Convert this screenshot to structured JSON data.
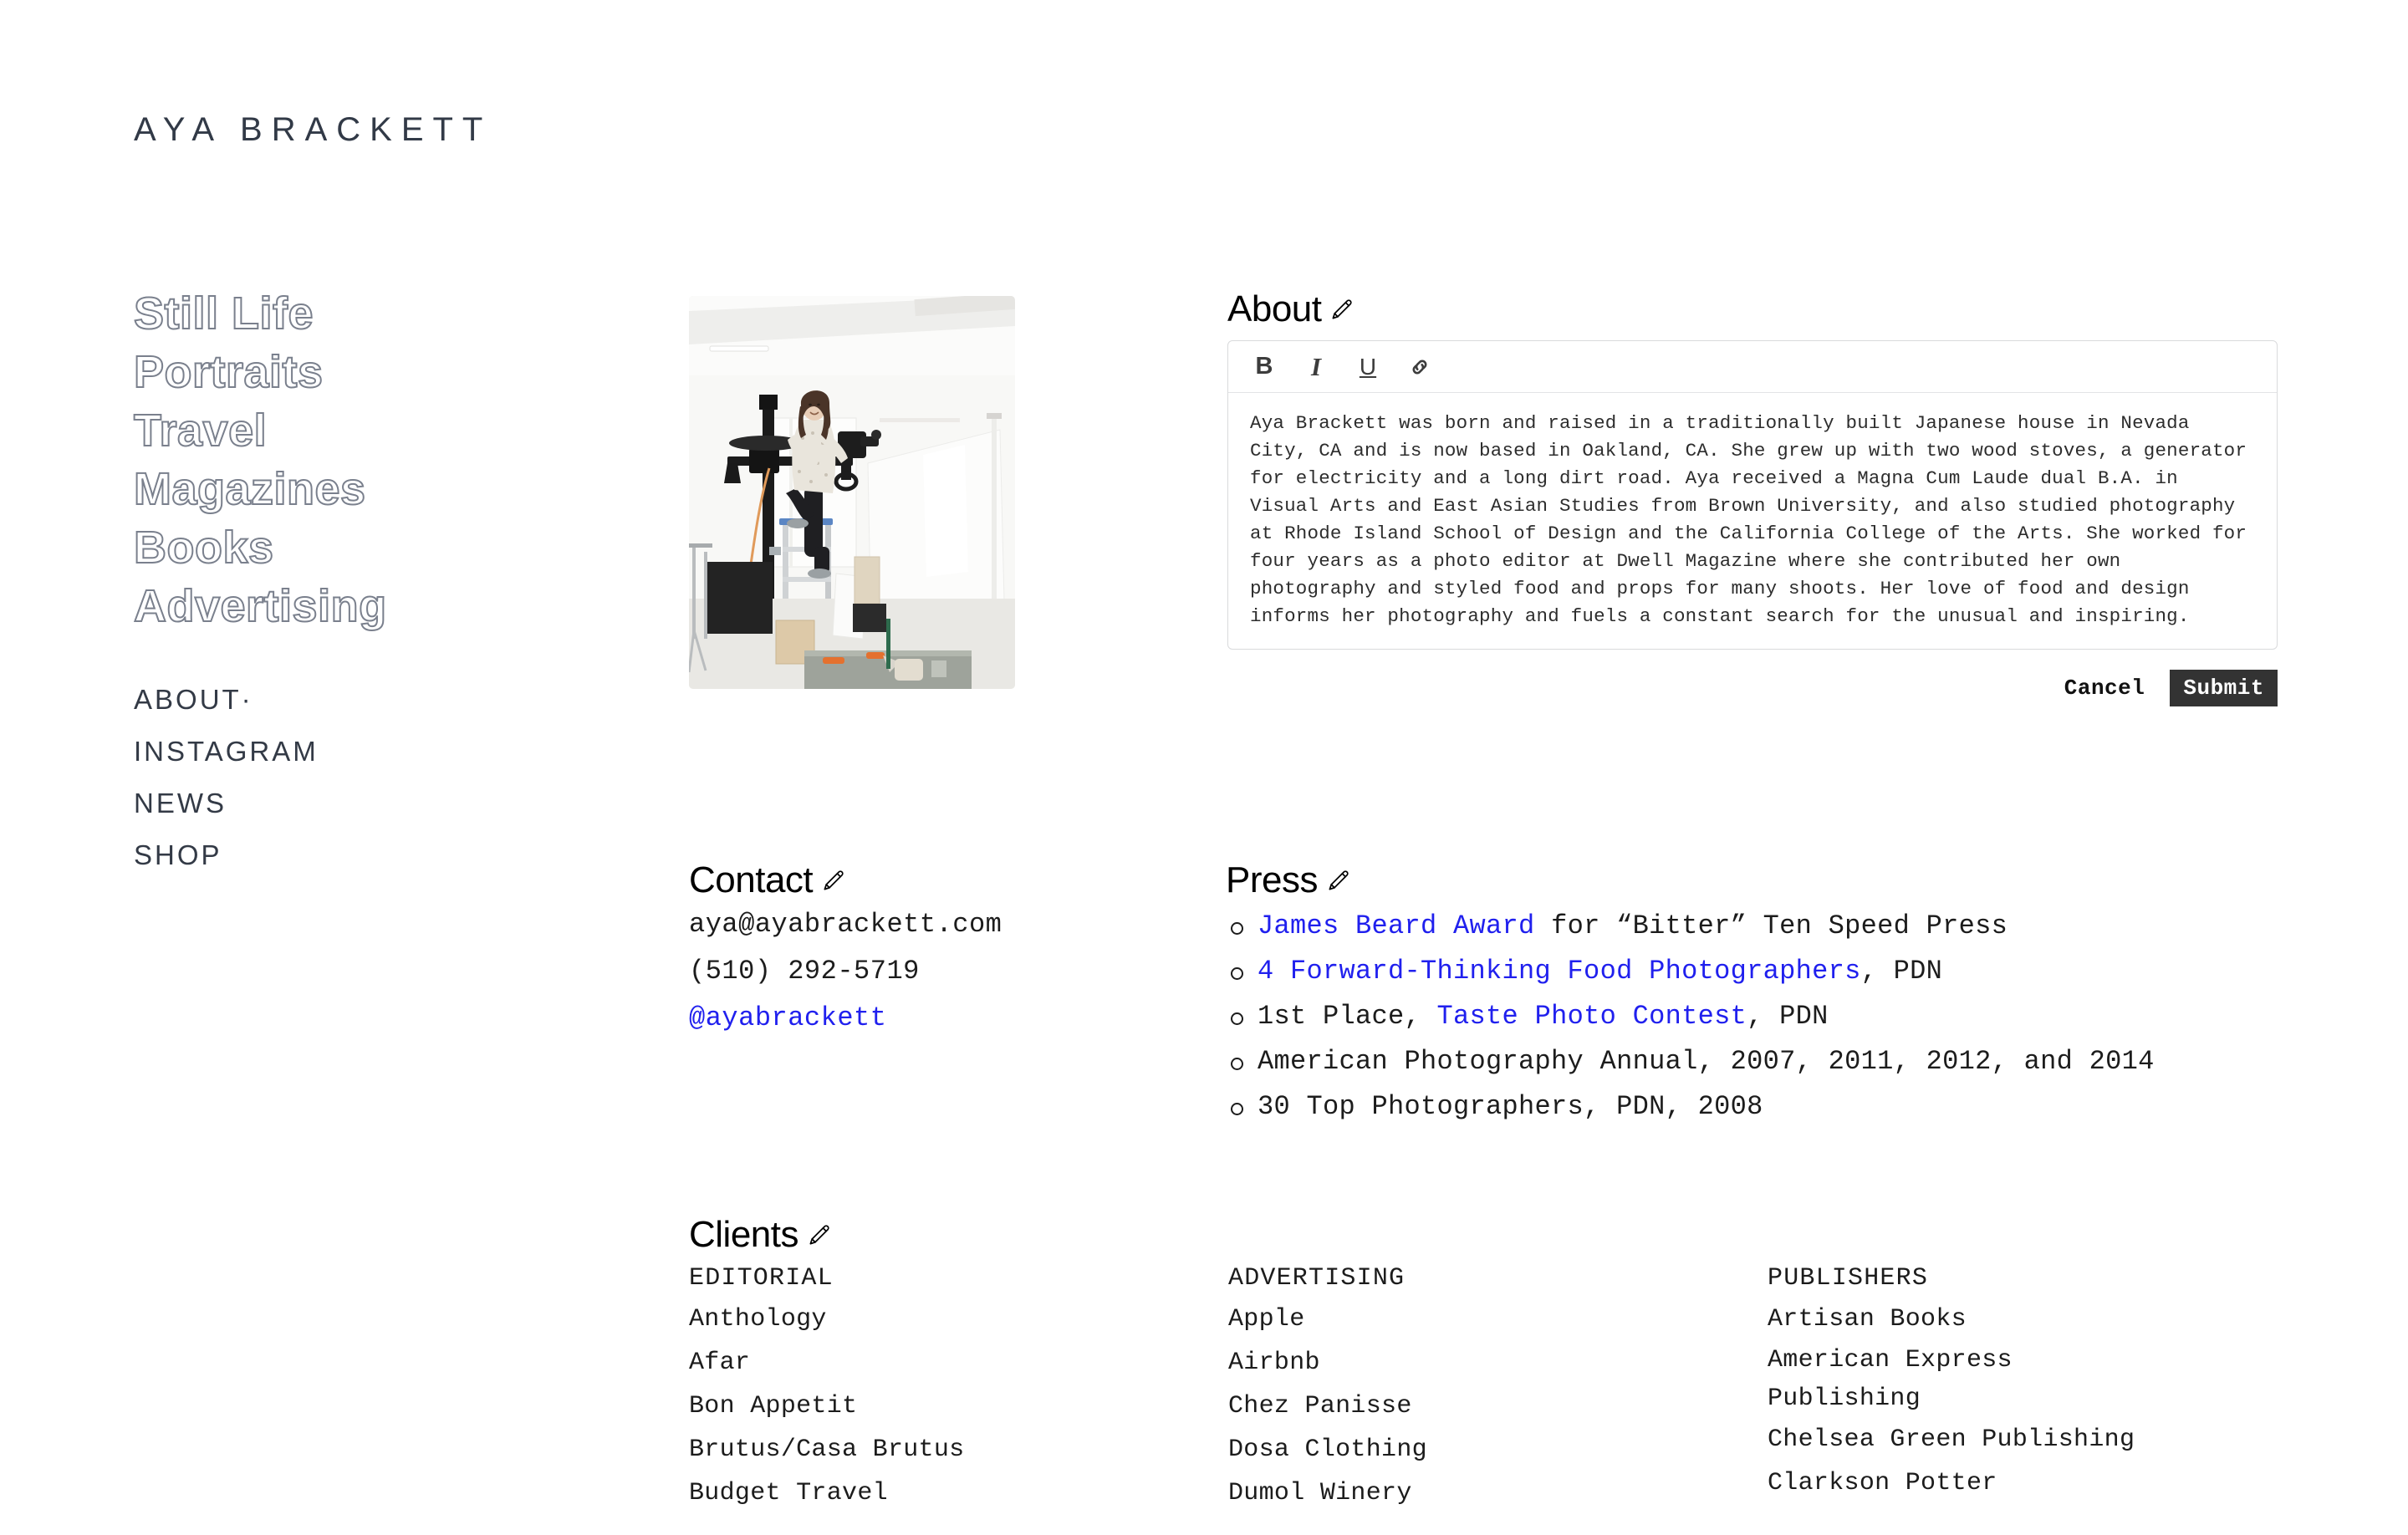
{
  "site": {
    "title": "AYA BRACKETT"
  },
  "sidebar": {
    "categories": [
      {
        "label": "Still Life"
      },
      {
        "label": "Portraits"
      },
      {
        "label": "Travel"
      },
      {
        "label": "Magazines"
      },
      {
        "label": "Books"
      },
      {
        "label": "Advertising"
      }
    ],
    "nav": [
      {
        "label": "ABOUT·"
      },
      {
        "label": "INSTAGRAM"
      },
      {
        "label": "NEWS"
      },
      {
        "label": "SHOP"
      }
    ]
  },
  "photo": {
    "alt": "Aya Brackett standing on a ladder in a white photography studio with a camera on a boom stand"
  },
  "about": {
    "heading": "About",
    "edit_icon": "pencil-icon",
    "toolbar": {
      "bold": "B",
      "italic": "I",
      "underline": "U",
      "link": "link-icon"
    },
    "body": "Aya Brackett was born and raised in a traditionally built Japanese house in Nevada City, CA and is now based in Oakland, CA. She grew up with two wood stoves, a generator for electricity and a long dirt road. Aya received a Magna Cum Laude dual B.A. in Visual Arts and East Asian Studies from Brown University, and also studied photography at Rhode Island School of Design and the California College of the Arts. She worked for four years as a photo editor at Dwell Magazine where she contributed her own photography and styled food and props for many shoots. Her love of food and design informs her photography and fuels a constant search for the unusual and inspiring.",
    "cancel_label": "Cancel",
    "submit_label": "Submit"
  },
  "contact": {
    "heading": "Contact",
    "edit_icon": "pencil-icon",
    "email": "aya@ayabrackett.com",
    "phone": "(510) 292-5719",
    "instagram": "@ayabrackett"
  },
  "press": {
    "heading": "Press",
    "edit_icon": "pencil-icon",
    "items": [
      {
        "link": "James Beard Award",
        "before": "",
        "after": " for “Bitter” Ten Speed Press"
      },
      {
        "link": "4 Forward-Thinking Food Photographers",
        "before": "",
        "after": ", PDN"
      },
      {
        "link": "Taste Photo Contest",
        "before": "1st Place, ",
        "after": ", PDN"
      },
      {
        "link": "",
        "before": "American Photography Annual, 2007, 2011, 2012, and 2014",
        "after": ""
      },
      {
        "link": "",
        "before": "30 Top Photographers, PDN, 2008",
        "after": ""
      }
    ]
  },
  "clients": {
    "heading": "Clients",
    "edit_icon": "pencil-icon",
    "columns": [
      {
        "title": "EDITORIAL",
        "items": [
          "Anthology",
          "Afar",
          "Bon Appetit",
          "Brutus/Casa Brutus",
          "Budget Travel"
        ]
      },
      {
        "title": "ADVERTISING",
        "items": [
          "Apple",
          "Airbnb",
          "Chez Panisse",
          "Dosa Clothing",
          "Dumol Winery"
        ]
      },
      {
        "title": "PUBLISHERS",
        "items": [
          "Artisan Books",
          "American Express Publishing",
          "Chelsea Green Publishing",
          "Clarkson Potter"
        ]
      }
    ]
  },
  "colors": {
    "text": "#1c1c1c",
    "title": "#323a47",
    "link": "#2020ee",
    "outline": "#7a808d",
    "submit_bg": "#333333",
    "border": "#d9dadc"
  }
}
